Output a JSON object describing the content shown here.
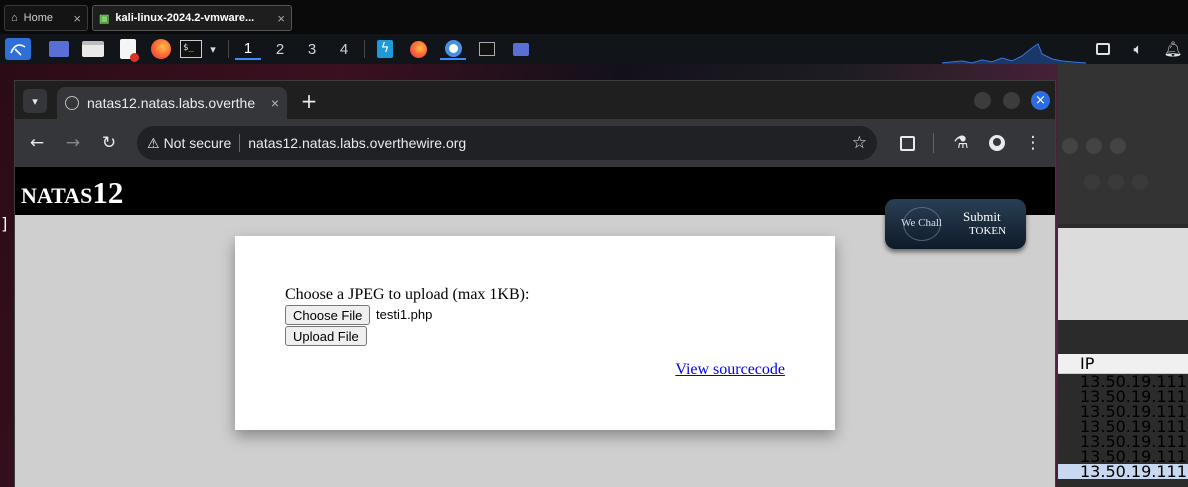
{
  "vm_tabs": {
    "home": "Home",
    "vm": "kali-linux-2024.2-vmware..."
  },
  "panel": {
    "workspaces": [
      "1",
      "2",
      "3",
      "4"
    ]
  },
  "chrome": {
    "tab_title": "natas12.natas.labs.overthe",
    "security_label": "Not secure",
    "url": "natas12.natas.labs.overthewire.org"
  },
  "page": {
    "header_prefix": "NATAS",
    "header_number": "12",
    "upload_label": "Choose a JPEG to upload (max 1KB):",
    "choose_file_button": "Choose File",
    "chosen_file": "testi1.php",
    "upload_button": "Upload File",
    "view_source_link": "View sourcecode",
    "wechall_logo": "We Chall",
    "submit_line1": "Submit",
    "submit_line2": "TOKEN"
  },
  "background_window": {
    "column_header": "IP",
    "rows": [
      "13.50.19.111",
      "13.50.19.111",
      "13.50.19.111",
      "13.50.19.111",
      "13.50.19.111",
      "13.50.19.111",
      "13.50.19.111"
    ]
  }
}
